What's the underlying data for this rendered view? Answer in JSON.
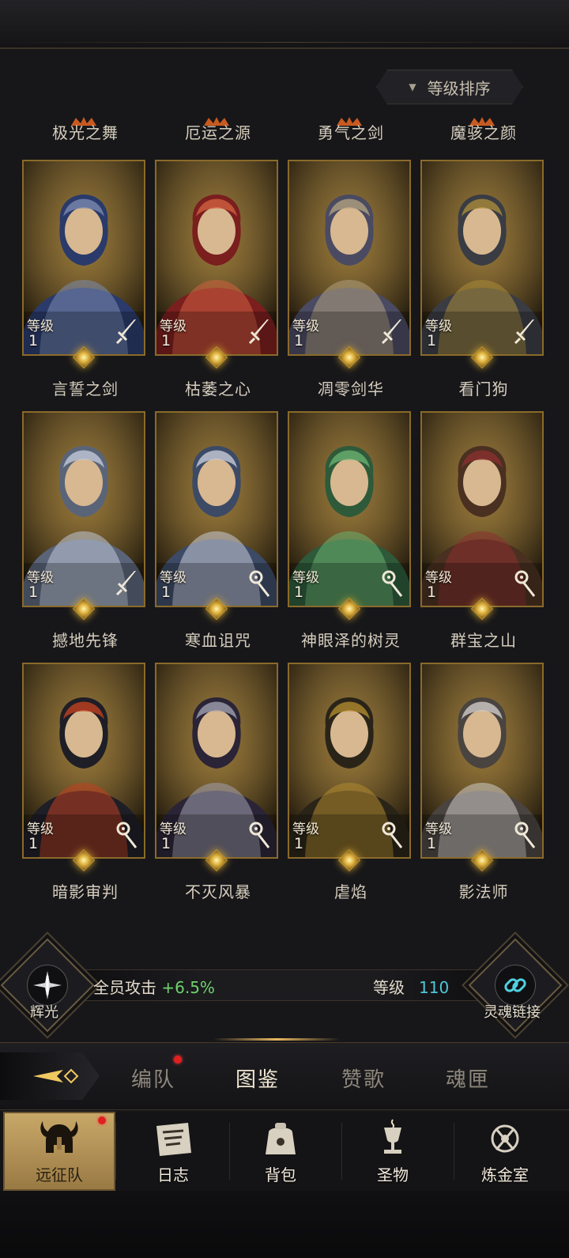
{
  "sort": {
    "label": "等级排序"
  },
  "heroes": [
    {
      "title": "极光之舞",
      "name": "言誓之剑",
      "level_label": "等级",
      "level": "1",
      "type_icon": "sword-icon",
      "palette": [
        "#2a3a6a",
        "#7a8ab0"
      ],
      "title_crown": true
    },
    {
      "title": "厄运之源",
      "name": "枯萎之心",
      "level_label": "等级",
      "level": "1",
      "type_icon": "sword-icon",
      "palette": [
        "#7a1e1e",
        "#d06040"
      ],
      "title_crown": true
    },
    {
      "title": "勇气之剑",
      "name": "凋零剑华",
      "level_label": "等级",
      "level": "1",
      "type_icon": "sword-icon",
      "palette": [
        "#4a4a62",
        "#b0a080"
      ],
      "title_crown": true
    },
    {
      "title": "魔骇之颜",
      "name": "看门狗",
      "level_label": "等级",
      "level": "1",
      "type_icon": "sword-icon",
      "palette": [
        "#3a3c44",
        "#a88a3a"
      ],
      "title_crown": true
    },
    {
      "title": "",
      "name": "撼地先锋",
      "level_label": "等级",
      "level": "1",
      "type_icon": "sword-icon",
      "palette": [
        "#5a6478",
        "#c0c8d8"
      ],
      "title_crown": false
    },
    {
      "title": "",
      "name": "寒血诅咒",
      "level_label": "等级",
      "level": "1",
      "type_icon": "staff-icon",
      "palette": [
        "#3c4a66",
        "#c8ccd8"
      ],
      "title_crown": false
    },
    {
      "title": "",
      "name": "神眼泽的树灵",
      "level_label": "等级",
      "level": "1",
      "type_icon": "staff-icon",
      "palette": [
        "#2e5a3a",
        "#6ab070"
      ],
      "title_crown": false
    },
    {
      "title": "",
      "name": "群宝之山",
      "level_label": "等级",
      "level": "1",
      "type_icon": "staff-icon",
      "palette": [
        "#4a3020",
        "#8a3030"
      ],
      "title_crown": false
    },
    {
      "title": "",
      "name": "暗影审判",
      "level_label": "等级",
      "level": "1",
      "type_icon": "staff-icon",
      "palette": [
        "#1e1e26",
        "#c04020"
      ],
      "title_crown": false
    },
    {
      "title": "",
      "name": "不灭风暴",
      "level_label": "等级",
      "level": "1",
      "type_icon": "staff-icon",
      "palette": [
        "#2a2436",
        "#a0a0b0"
      ],
      "title_crown": false
    },
    {
      "title": "",
      "name": "虐焰",
      "level_label": "等级",
      "level": "1",
      "type_icon": "staff-icon",
      "palette": [
        "#2a2418",
        "#b08a30"
      ],
      "title_crown": false
    },
    {
      "title": "",
      "name": "影法师",
      "level_label": "等级",
      "level": "1",
      "type_icon": "staff-icon",
      "palette": [
        "#4a4440",
        "#d0ccc8"
      ],
      "title_crown": false
    }
  ],
  "bonus": {
    "left_emblem_label": "辉光",
    "attack_label": "全员攻击",
    "attack_value": "+6.5%",
    "level_label": "等级",
    "level_value": "110",
    "right_emblem_label": "灵魂链接"
  },
  "tabs": [
    {
      "label": "编队",
      "badge": true
    },
    {
      "label": "图鉴",
      "badge": false,
      "active": true
    },
    {
      "label": "赞歌",
      "badge": false
    },
    {
      "label": "魂匣",
      "badge": false
    }
  ],
  "nav": [
    {
      "label": "远征队",
      "icon": "viking-helmet-icon",
      "active": true,
      "badge": true
    },
    {
      "label": "日志",
      "icon": "scroll-map-icon",
      "active": false,
      "badge": false
    },
    {
      "label": "背包",
      "icon": "bag-icon",
      "active": false,
      "badge": false
    },
    {
      "label": "圣物",
      "icon": "chalice-icon",
      "active": false,
      "badge": false
    },
    {
      "label": "炼金室",
      "icon": "alchemy-icon",
      "active": false,
      "badge": false
    }
  ],
  "colors": {
    "accent_gold": "#c8a050",
    "bonus_green": "#6fd26a",
    "level_cyan": "#4fc8d8",
    "badge_red": "#e02020"
  }
}
